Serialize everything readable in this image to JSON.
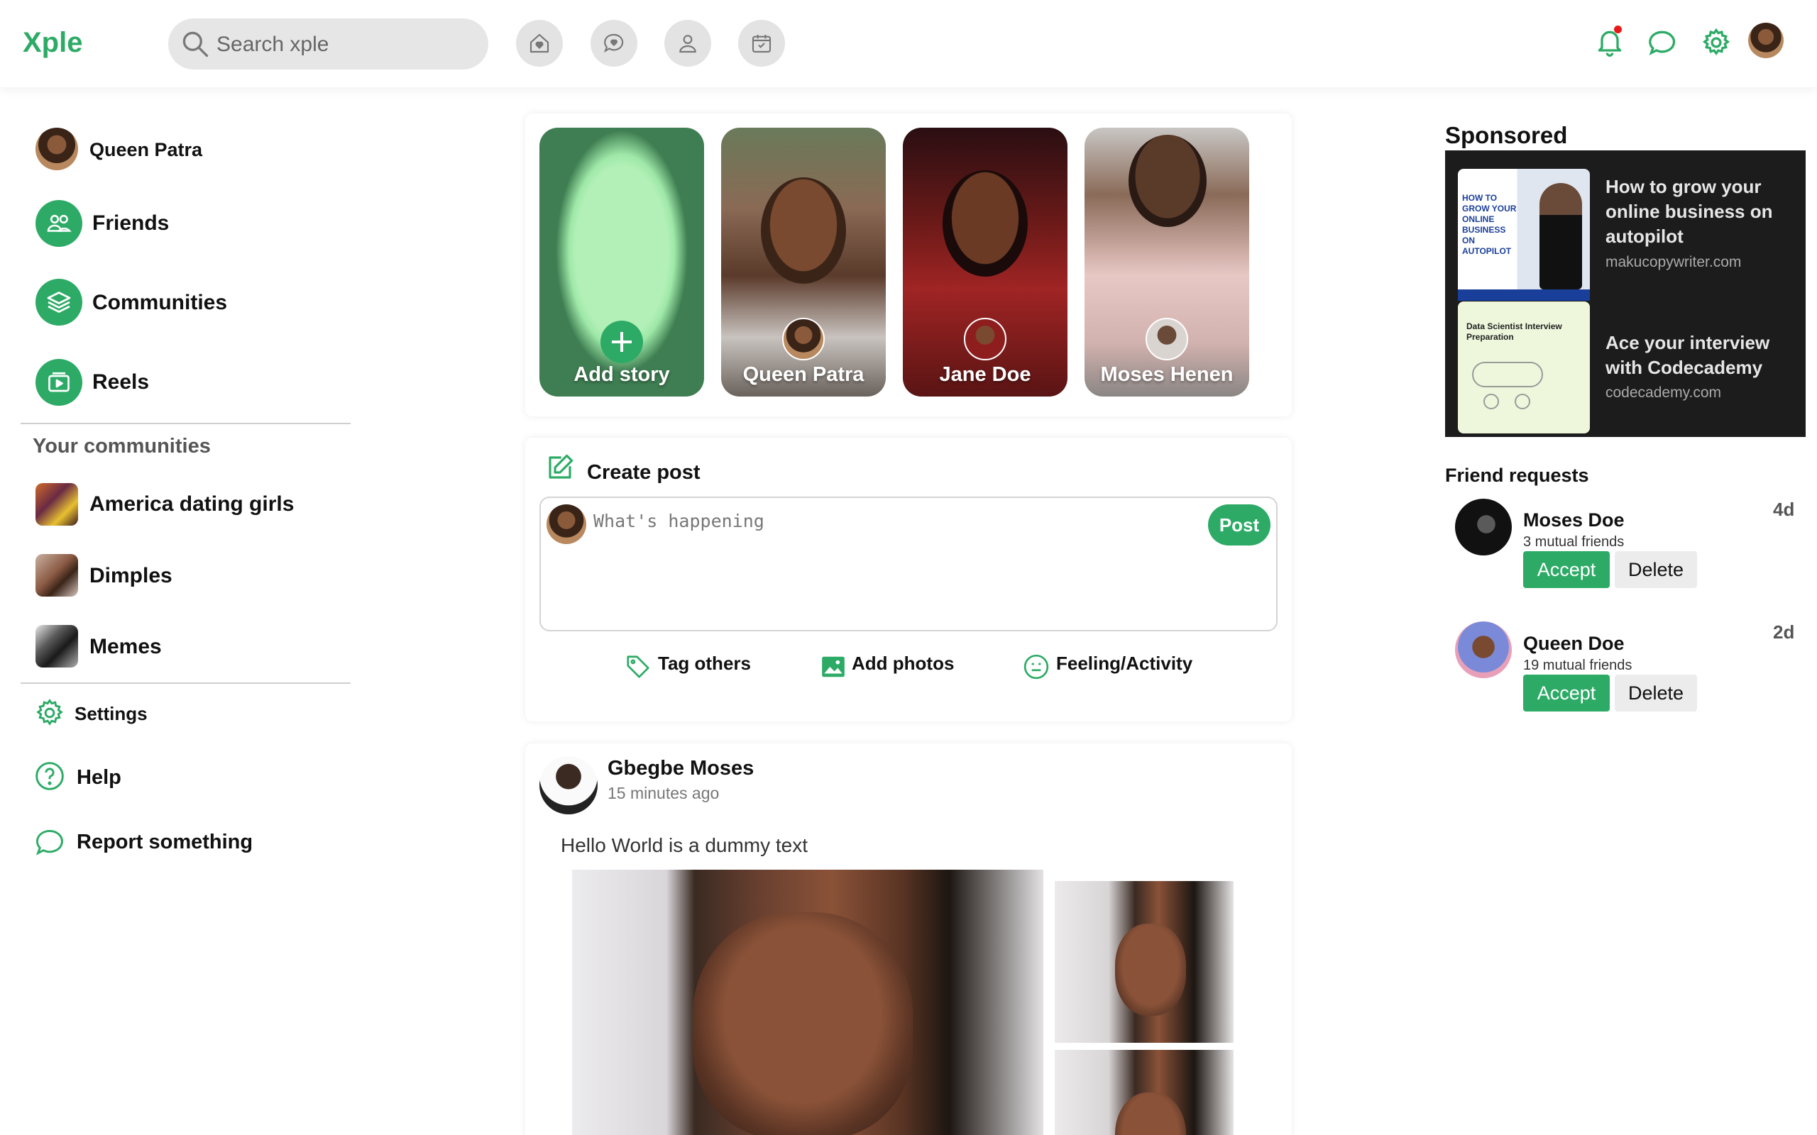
{
  "header": {
    "logo": "Xple",
    "search_placeholder": "Search xple",
    "nav_icons": [
      "home-heart-icon",
      "message-heart-icon",
      "user-icon",
      "calendar-icon"
    ],
    "right_icons": [
      "bell-icon",
      "chat-icon",
      "gear-icon",
      "profile-avatar"
    ]
  },
  "sidebar": {
    "profile_name": "Queen Patra",
    "items": [
      {
        "label": "Friends",
        "icon": "friends-icon"
      },
      {
        "label": "Communities",
        "icon": "layers-icon"
      },
      {
        "label": "Reels",
        "icon": "reels-icon"
      }
    ],
    "communities_title": "Your communities",
    "communities": [
      {
        "label": "America dating girls"
      },
      {
        "label": "Dimples"
      },
      {
        "label": "Memes"
      }
    ],
    "bottom_items": [
      {
        "label": "Settings",
        "icon": "gear-icon"
      },
      {
        "label": "Help",
        "icon": "help-icon"
      },
      {
        "label": "Report something",
        "icon": "chat-bubble-icon"
      }
    ]
  },
  "stories": [
    {
      "label": "Add story"
    },
    {
      "label": "Queen Patra"
    },
    {
      "label": "Jane Doe"
    },
    {
      "label": "Moses Henen"
    }
  ],
  "create_post": {
    "title": "Create post",
    "placeholder": "What's happening",
    "post_button": "Post",
    "actions": [
      {
        "label": "Tag others",
        "icon": "tag-icon"
      },
      {
        "label": "Add photos",
        "icon": "image-icon"
      },
      {
        "label": "Feeling/Activity",
        "icon": "smiley-icon"
      }
    ]
  },
  "feed_post": {
    "author": "Gbegbe Moses",
    "time": "15 minutes ago",
    "text": "Hello World is a dummy text"
  },
  "sponsored": {
    "title": "Sponsored",
    "ads": [
      {
        "title": "How to grow your online business on autopilot",
        "site": "makucopywriter.com",
        "thumb_text": "HOW TO GROW YOUR ONLINE BUSINESS ON AUTOPILOT"
      },
      {
        "title": "Ace your interview with Codecademy",
        "site": "codecademy.com",
        "thumb_text": "Data Scientist Interview Preparation"
      }
    ]
  },
  "friend_requests": {
    "title": "Friend requests",
    "accept_label": "Accept",
    "delete_label": "Delete",
    "items": [
      {
        "name": "Moses Doe",
        "mutual": "3 mutual friends",
        "time": "4d"
      },
      {
        "name": "Queen Doe",
        "mutual": "19 mutual friends",
        "time": "2d"
      }
    ]
  },
  "colors": {
    "accent": "#2dab66",
    "notification_dot": "#e81818",
    "sponsored_bg": "#1c1c1c"
  }
}
